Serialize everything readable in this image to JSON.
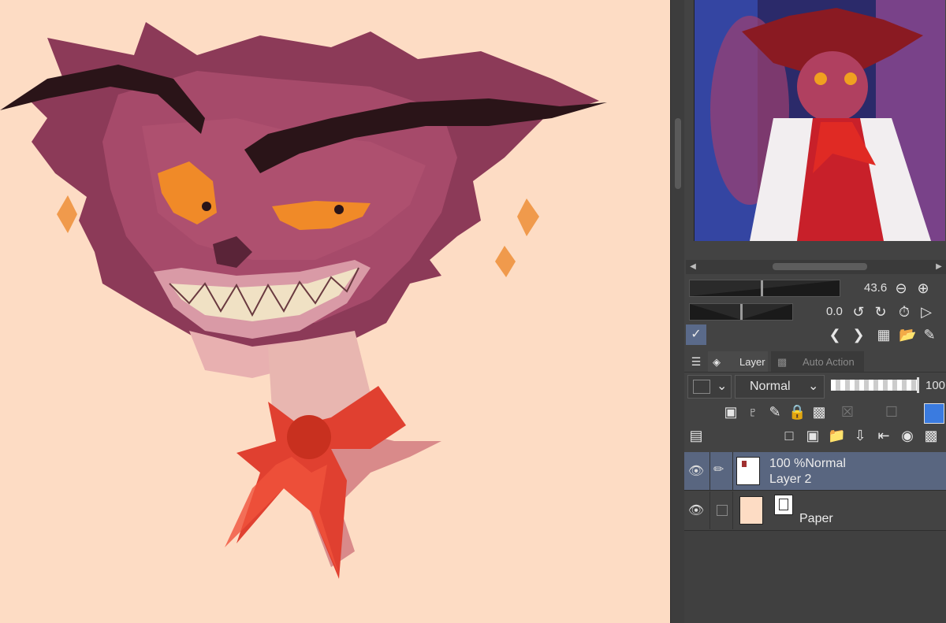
{
  "panel": {
    "zoom_value": "43.6",
    "rotate_value": "0.0",
    "tabs": [
      {
        "label": "Layer",
        "active": true
      },
      {
        "label": "Auto Action",
        "active": false
      }
    ],
    "blend_mode": "Normal",
    "opacity_value": "100",
    "layers": [
      {
        "status": "100 %Normal",
        "name": "Layer 2",
        "selected": true
      },
      {
        "status": "",
        "name": "Paper",
        "selected": false
      }
    ]
  },
  "colors": {
    "canvas_bg": "#fddcc4",
    "panel_bg": "#434343",
    "selected_layer": "#596680",
    "accent_blue": "#3a7be0"
  },
  "icons": [
    "layers-icon",
    "eye-icon",
    "pen-icon",
    "lock-icon",
    "zoom-out-icon",
    "zoom-in-icon",
    "rotate-left-icon",
    "rotate-right-icon",
    "reset-rotation-icon",
    "flip-icon",
    "eyedropper-icon",
    "prev-icon",
    "next-icon",
    "grid-icon",
    "open-folder-icon",
    "edit-icon",
    "new-layer-icon",
    "new-folder-icon",
    "mask-icon",
    "paper-icon"
  ]
}
